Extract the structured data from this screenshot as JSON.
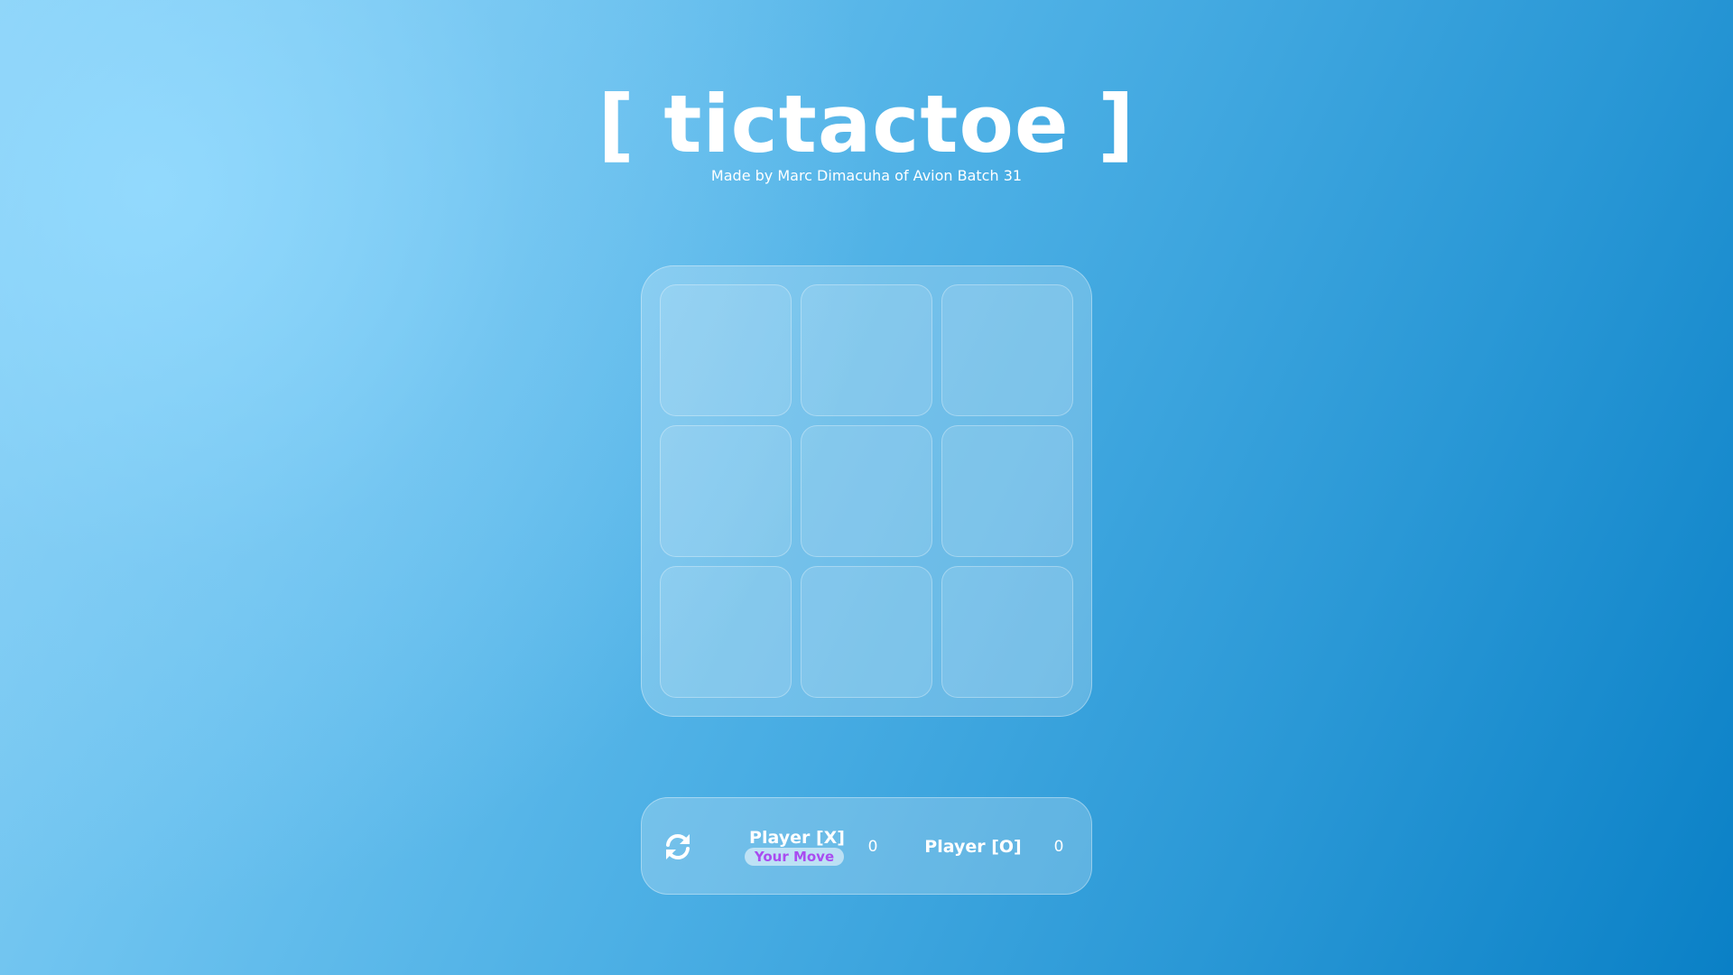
{
  "header": {
    "title": "[ tictactoe ]",
    "subtitle": "Made by Marc Dimacuha of Avion Batch 31"
  },
  "board": {
    "cells": [
      "",
      "",
      "",
      "",
      "",
      "",
      "",
      "",
      ""
    ]
  },
  "scoreboard": {
    "restart_icon": "refresh-icon",
    "player_x": {
      "label": "Player [X]",
      "status": "Your Move",
      "score": "0"
    },
    "player_o": {
      "label": "Player [O]",
      "score": "0"
    }
  },
  "colors": {
    "status_text": "#a94cf0",
    "text": "#ffffff"
  }
}
